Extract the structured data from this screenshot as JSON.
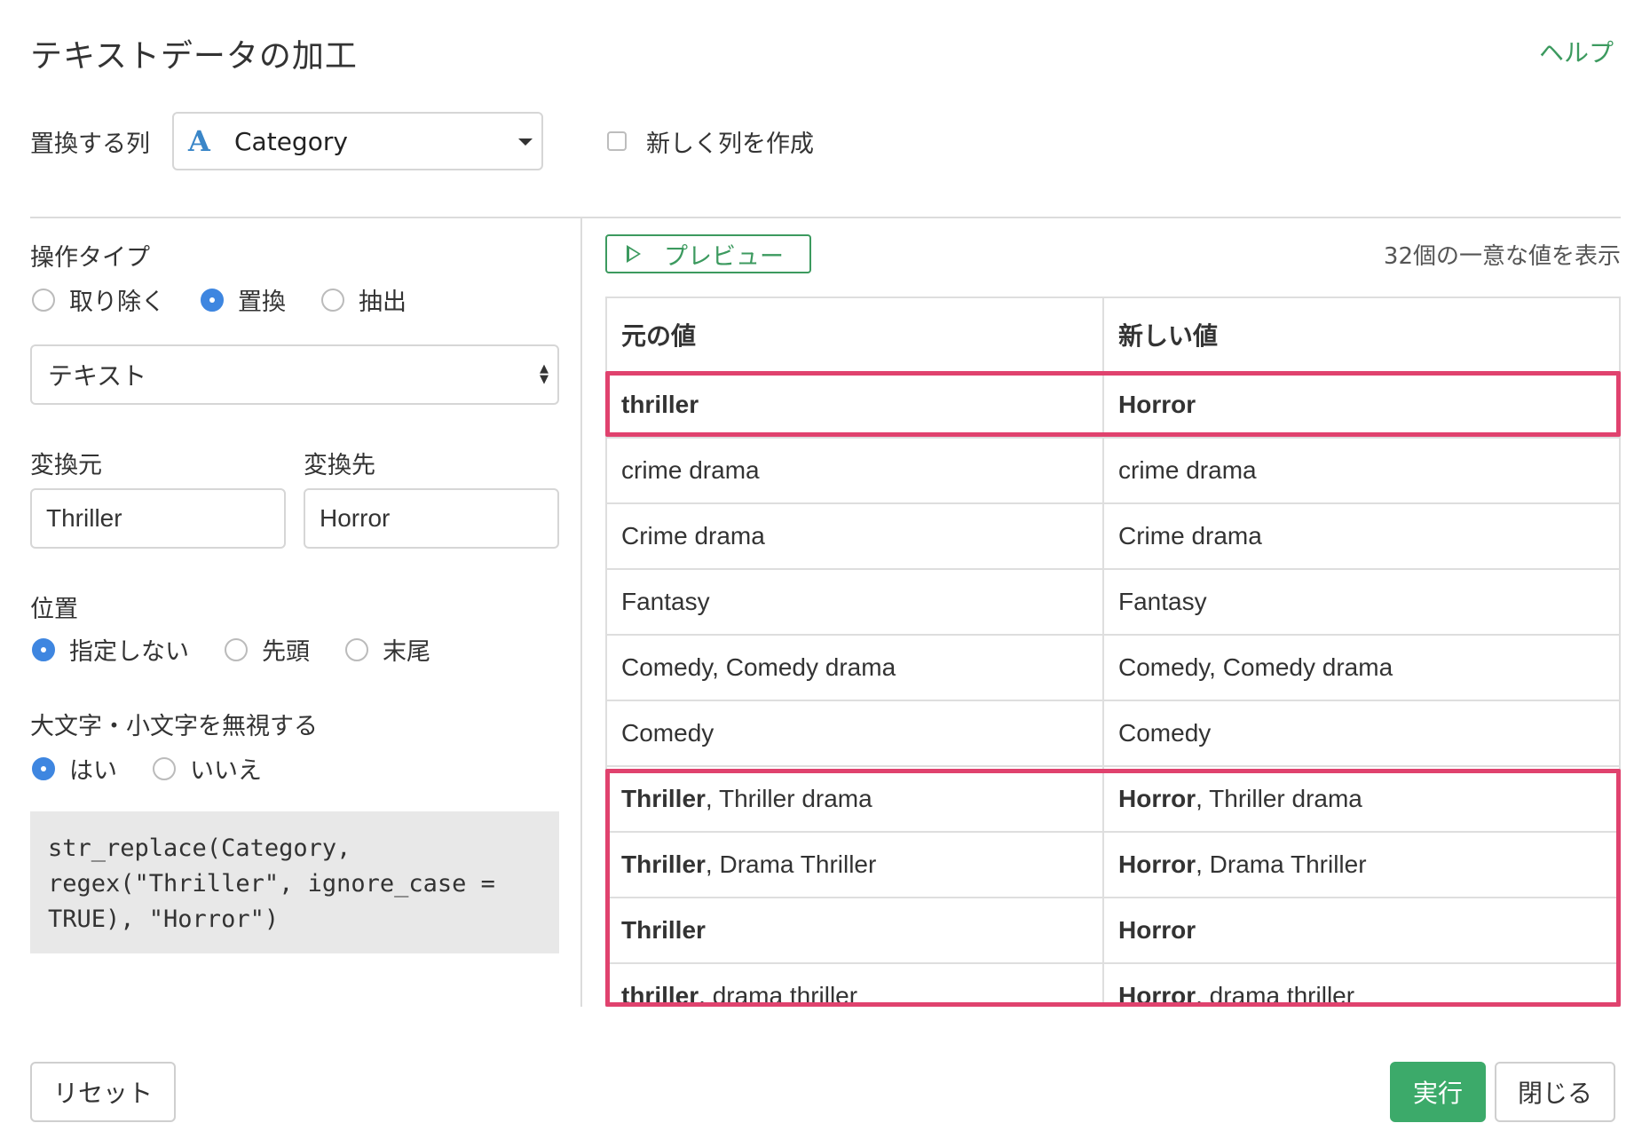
{
  "dialog": {
    "title": "テキストデータの加工",
    "help_label": "ヘルプ"
  },
  "column": {
    "label": "置換する列",
    "type_icon": "A",
    "selected": "Category",
    "new_column_label": "新しく列を作成"
  },
  "operation": {
    "label": "操作タイプ",
    "options": [
      {
        "label": "取り除く",
        "checked": false
      },
      {
        "label": "置換",
        "checked": true
      },
      {
        "label": "抽出",
        "checked": false
      }
    ],
    "text_type": "テキスト"
  },
  "replace": {
    "from_label": "変換元",
    "from_value": "Thriller",
    "to_label": "変換先",
    "to_value": "Horror"
  },
  "position": {
    "label": "位置",
    "options": [
      {
        "label": "指定しない",
        "checked": true
      },
      {
        "label": "先頭",
        "checked": false
      },
      {
        "label": "末尾",
        "checked": false
      }
    ]
  },
  "ignore_case": {
    "label": "大文字・小文字を無視する",
    "options": [
      {
        "label": "はい",
        "checked": true
      },
      {
        "label": "いいえ",
        "checked": false
      }
    ]
  },
  "code": "str_replace(Category,\nregex(\"Thriller\", ignore_case =\nTRUE), \"Horror\")",
  "preview": {
    "button_label": "プレビュー",
    "unique_count": "32個の一意な値を表示",
    "columns": [
      "元の値",
      "新しい値"
    ],
    "rows": [
      {
        "orig_bold": "thriller",
        "orig_rest": "",
        "new_bold": "Horror",
        "new_rest": ""
      },
      {
        "orig_bold": "",
        "orig_rest": "crime drama",
        "new_bold": "",
        "new_rest": "crime drama"
      },
      {
        "orig_bold": "",
        "orig_rest": "Crime drama",
        "new_bold": "",
        "new_rest": "Crime drama"
      },
      {
        "orig_bold": "",
        "orig_rest": "Fantasy",
        "new_bold": "",
        "new_rest": "Fantasy"
      },
      {
        "orig_bold": "",
        "orig_rest": "Comedy, Comedy drama",
        "new_bold": "",
        "new_rest": "Comedy, Comedy drama"
      },
      {
        "orig_bold": "",
        "orig_rest": "Comedy",
        "new_bold": "",
        "new_rest": "Comedy"
      },
      {
        "orig_bold": "Thriller",
        "orig_rest": ", Thriller drama",
        "new_bold": "Horror",
        "new_rest": ", Thriller drama"
      },
      {
        "orig_bold": "Thriller",
        "orig_rest": ", Drama Thriller",
        "new_bold": "Horror",
        "new_rest": ", Drama Thriller"
      },
      {
        "orig_bold": "Thriller",
        "orig_rest": "",
        "new_bold": "Horror",
        "new_rest": ""
      },
      {
        "orig_bold": "thriller",
        "orig_rest": ", drama thriller",
        "new_bold": "Horror",
        "new_rest": ", drama thriller"
      }
    ]
  },
  "footer": {
    "reset_label": "リセット",
    "run_label": "実行",
    "close_label": "閉じる"
  },
  "colors": {
    "accent_green": "#3c9a5f",
    "run_button": "#3caa6a",
    "highlight": "#e0426e",
    "radio_checked": "#3e86e0",
    "type_icon": "#3a86c8"
  }
}
